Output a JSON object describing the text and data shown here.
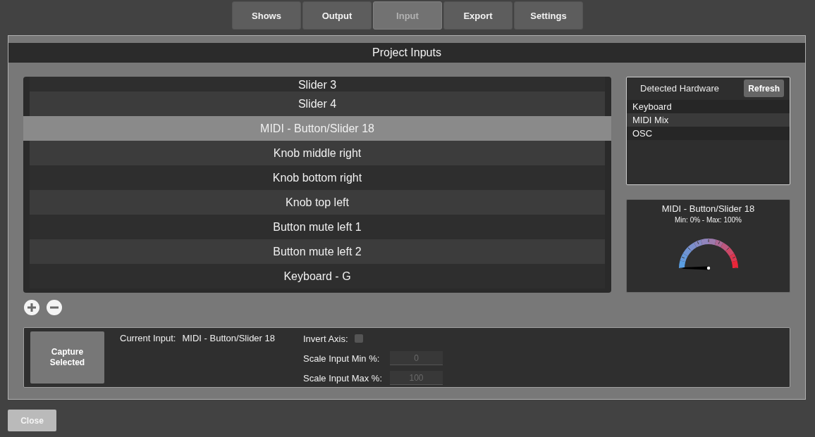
{
  "tabs": [
    {
      "label": "Shows",
      "selected": false
    },
    {
      "label": "Output",
      "selected": false
    },
    {
      "label": "Input",
      "selected": true
    },
    {
      "label": "Export",
      "selected": false
    },
    {
      "label": "Settings",
      "selected": false
    }
  ],
  "panel": {
    "title": "Project Inputs"
  },
  "inputs": [
    {
      "label": "Slider 3",
      "selected": false
    },
    {
      "label": "Slider 4",
      "selected": false
    },
    {
      "label": "MIDI - Button/Slider 18",
      "selected": true
    },
    {
      "label": "Knob middle right",
      "selected": false
    },
    {
      "label": "Knob bottom right",
      "selected": false
    },
    {
      "label": "Knob top left",
      "selected": false
    },
    {
      "label": "Button mute left 1",
      "selected": false
    },
    {
      "label": "Button mute left 2",
      "selected": false
    },
    {
      "label": "Keyboard - G",
      "selected": false
    }
  ],
  "hardware": {
    "title": "Detected Hardware",
    "refresh": "Refresh",
    "items": [
      {
        "label": "Keyboard"
      },
      {
        "label": "MIDI Mix"
      },
      {
        "label": "OSC"
      }
    ]
  },
  "monitor": {
    "name": "MIDI - Button/Slider 18",
    "range": "Min: 0% - Max: 100%",
    "level": 0
  },
  "settings": {
    "capture": "Capture Selected",
    "current_input_label": "Current Input:",
    "current_input": "MIDI - Button/Slider 18",
    "invert_label": "Invert Axis:",
    "invert_checked": false,
    "min_label": "Scale Input Min %:",
    "min_value": "0",
    "max_label": "Scale Input Max %:",
    "max_value": "100"
  },
  "close": "Close"
}
